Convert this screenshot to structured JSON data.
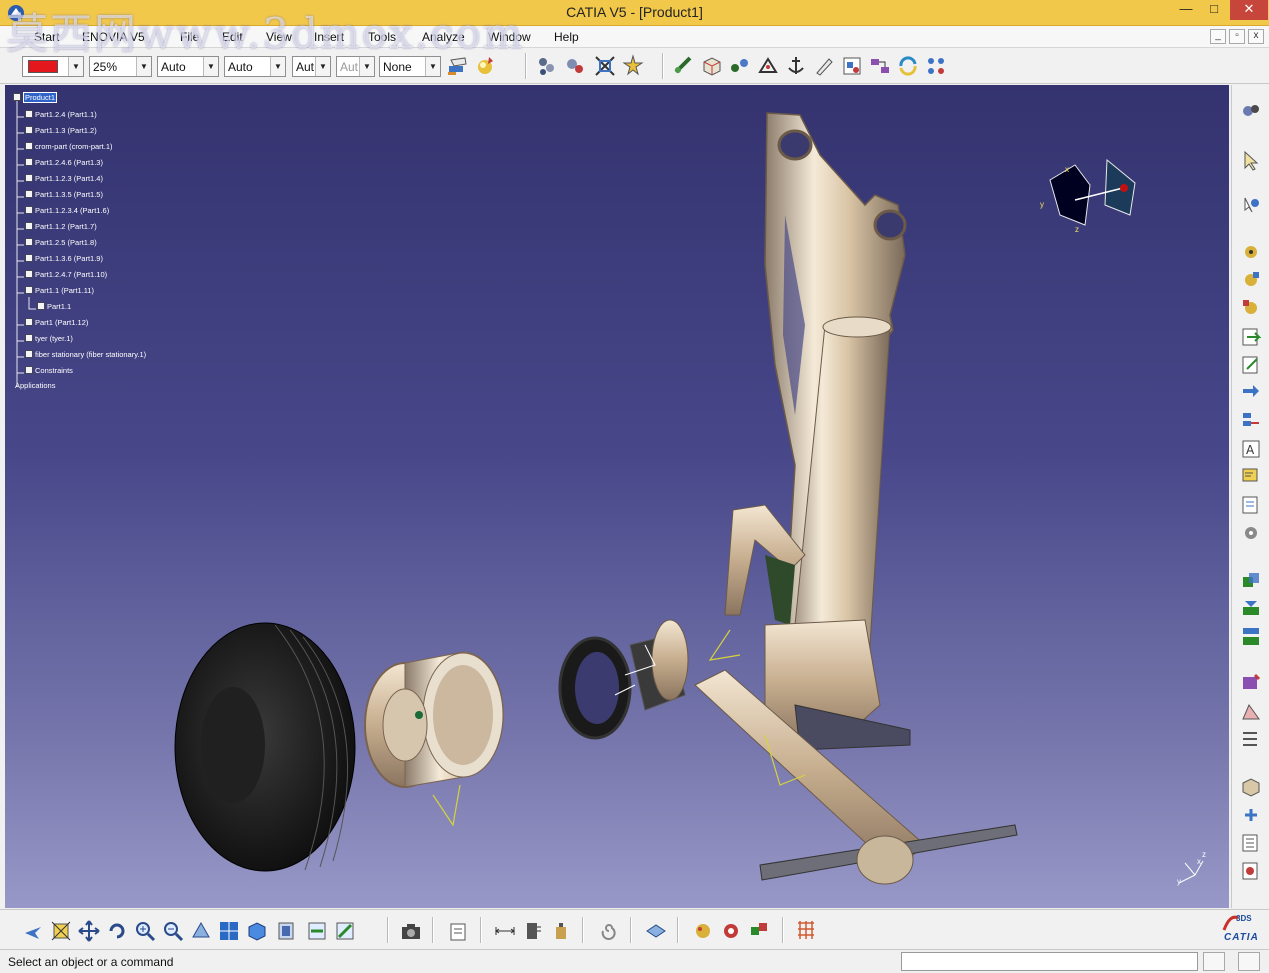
{
  "window": {
    "title": "CATIA V5 - [Product1]",
    "minimize": "—",
    "maximize": "□",
    "close": "✕"
  },
  "watermark": "莫西网www.3dmox.com",
  "menu": {
    "items": [
      "Start",
      "ENOVIA V5",
      "File",
      "Edit",
      "View",
      "Insert",
      "Tools",
      "Analyze",
      "Window",
      "Help"
    ],
    "mdi_min": "_",
    "mdi_restore": "▫",
    "mdi_close": "x"
  },
  "toolbar": {
    "color_value": "",
    "transparency": "25%",
    "line_thickness": "Auto",
    "line_type": "Auto",
    "point_symbol": "Aut",
    "layer_disabled": "Aut",
    "layer": "None",
    "accent_color": "#e3171c"
  },
  "tree": {
    "root": "Product1",
    "nodes": [
      "Part1.2.4 (Part1.1)",
      "Part1.1.3 (Part1.2)",
      "crom-part (crom-part.1)",
      "Part1.2.4.6 (Part1.3)",
      "Part1.1.2.3 (Part1.4)",
      "Part1.1.3.5 (Part1.5)",
      "Part1.1.2.3.4 (Part1.6)",
      "Part1.1.2 (Part1.7)",
      "Part1.2.5 (Part1.8)",
      "Part1.1.3.6 (Part1.9)",
      "Part1.2.4.7 (Part1.10)",
      "Part1.1 (Part1.11)",
      "Part1.1",
      "Part1 (Part1.12)",
      "tyer (tyer.1)",
      "fiber stationary (fiber stationary.1)",
      "Constraints",
      "Applications"
    ]
  },
  "viewport": {
    "compass_labels": [
      "x",
      "y",
      "z"
    ],
    "axis_labels": [
      "x",
      "y",
      "z"
    ],
    "bg_top": "#34336f",
    "bg_bottom": "#9898c8"
  },
  "status": {
    "message": "Select an object or a command",
    "command_value": ""
  },
  "brand": {
    "logo_text": "CATIA",
    "logo_mark": "3DS"
  }
}
